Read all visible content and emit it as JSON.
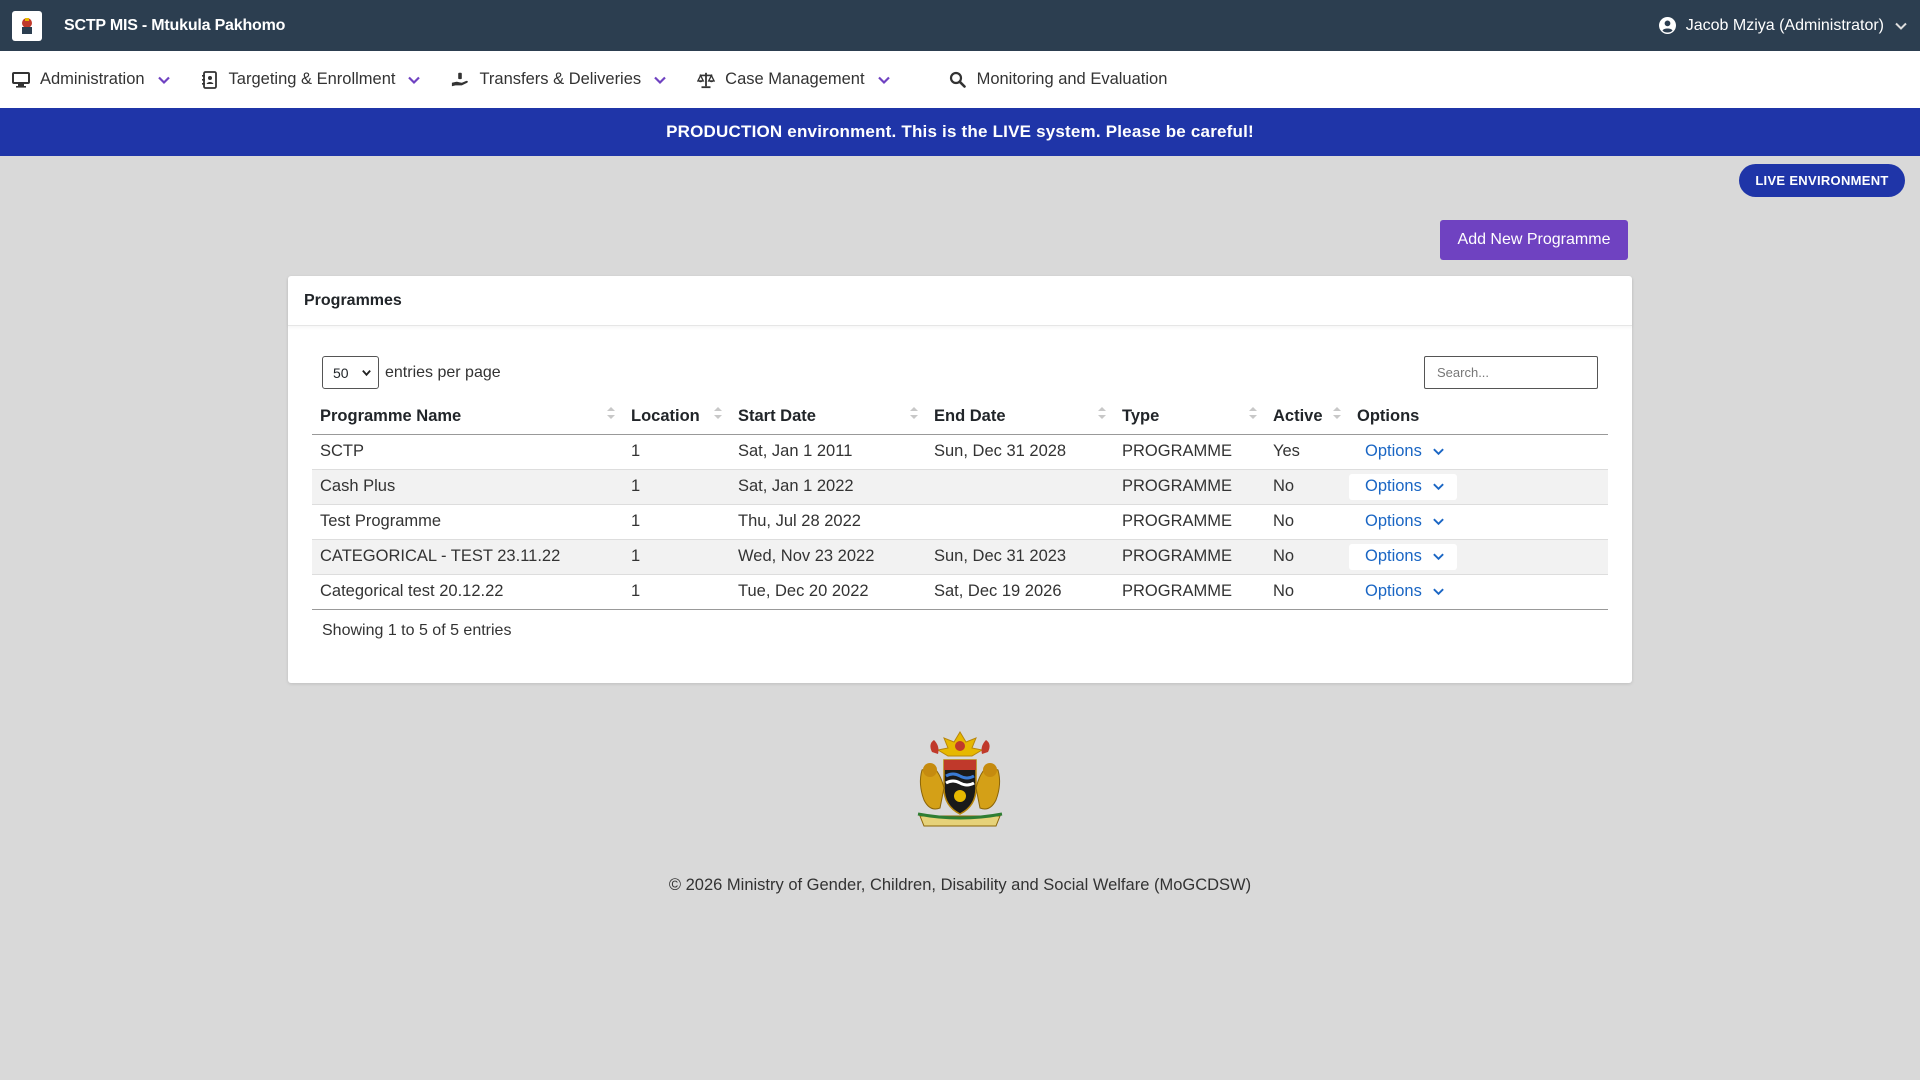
{
  "app": {
    "title": "SCTP MIS - Mtukula Pakhomo"
  },
  "user": {
    "name": "Jacob Mziya (Administrator)"
  },
  "nav": {
    "administration": "Administration",
    "targeting": "Targeting & Enrollment",
    "transfers": "Transfers & Deliveries",
    "case_management": "Case Management",
    "monitoring": "Monitoring and Evaluation"
  },
  "banner": {
    "text": "PRODUCTION environment. This is the LIVE system. Please be careful!"
  },
  "env_badge": "LIVE ENVIRONMENT",
  "add_button": "Add New Programme",
  "card": {
    "title": "Programmes",
    "page_size": "50",
    "entries_label": "entries per page",
    "search_placeholder": "Search...",
    "columns": [
      "Programme Name",
      "Location",
      "Start Date",
      "End Date",
      "Type",
      "Active",
      "Options"
    ],
    "rows": [
      {
        "name": "SCTP",
        "location": "1",
        "start": "Sat, Jan 1 2011",
        "end": "Sun, Dec 31 2028",
        "type": "PROGRAMME",
        "active": "Yes",
        "options": "Options"
      },
      {
        "name": "Cash Plus",
        "location": "1",
        "start": "Sat, Jan 1 2022",
        "end": "",
        "type": "PROGRAMME",
        "active": "No",
        "options": "Options"
      },
      {
        "name": "Test Programme",
        "location": "1",
        "start": "Thu, Jul 28 2022",
        "end": "",
        "type": "PROGRAMME",
        "active": "No",
        "options": "Options"
      },
      {
        "name": "CATEGORICAL - TEST 23.11.22",
        "location": "1",
        "start": "Wed, Nov 23 2022",
        "end": "Sun, Dec 31 2023",
        "type": "PROGRAMME",
        "active": "No",
        "options": "Options"
      },
      {
        "name": "Categorical test 20.12.22",
        "location": "1",
        "start": "Tue, Dec 20 2022",
        "end": "Sat, Dec 19 2026",
        "type": "PROGRAMME",
        "active": "No",
        "options": "Options"
      }
    ],
    "showing": "Showing 1 to 5 of 5 entries"
  },
  "footer": {
    "text": "© 2026 Ministry of Gender, Children, Disability and Social Welfare (MoGCDSW)"
  },
  "colors": {
    "topbar": "#2c3e50",
    "banner": "#1f35a8",
    "accent": "#6f42c1",
    "link": "#1a66c4"
  }
}
